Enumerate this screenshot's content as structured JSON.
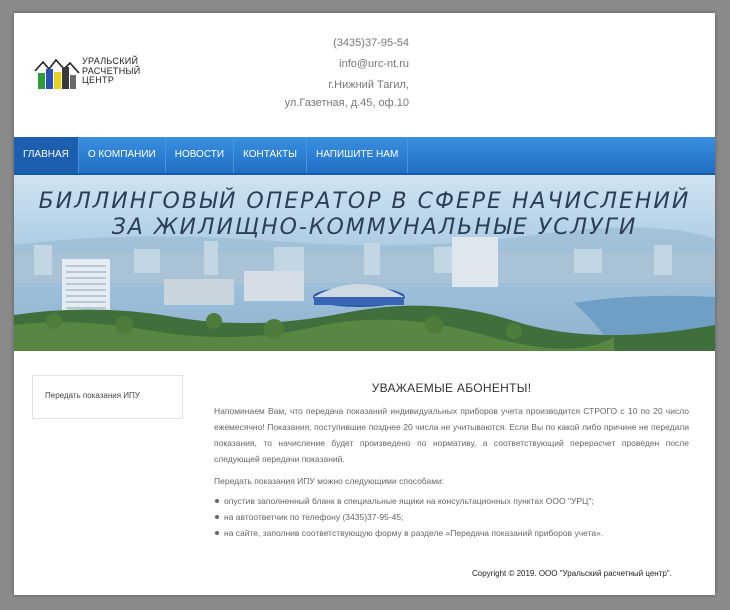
{
  "header": {
    "logo_text": "Уральский\nрасчетный\nцентр",
    "phone": "(3435)37-95-54",
    "email": "info@urc-nt.ru",
    "city": "г.Нижний Тагил,",
    "address": "ул.Газетная, д.45, оф.10"
  },
  "nav": {
    "items": [
      {
        "label": "Главная"
      },
      {
        "label": "О компании"
      },
      {
        "label": "Новости"
      },
      {
        "label": "Контакты"
      },
      {
        "label": "Напишите нам"
      }
    ]
  },
  "banner": {
    "line1": "Биллинговый оператор в сфере начислений",
    "line2": "за жилищно-коммунальные услуги"
  },
  "sidebar": {
    "link": "Передать показания ИПУ"
  },
  "main": {
    "title": "УВАЖАЕМЫЕ АБОНЕНТЫ!",
    "paragraph": "Напоминаем Вам, что передача показаний индивидуальных приборов учета производится СТРОГО с 10 по 20 число ежемесячно! Показания, поступившие позднее 20 числа не учитываются. Если Вы по какой либо причине не передали показания, то начисление будет произведено по нормативу, а соответствующий перерасчет проведен после следующей передачи показаний.",
    "ways_intro": "Передать показания ИПУ можно следующими способами:",
    "ways": [
      "опустив заполненный бланк в специальные ящики на консультационных пунктах ООО \"УРЦ\";",
      "на автоответчик по телефону (3435)37-95-45;",
      "на сайте, заполнив соответствующую форму в разделе «Передача показаний приборов учета»."
    ]
  },
  "footer": {
    "copyright": "Copyright © 2019. ООО \"Уральский расчетный центр\"."
  },
  "colors": {
    "nav": "#2a7fd4",
    "nav_active": "#1b5fae",
    "background": "#8a8a8a"
  }
}
